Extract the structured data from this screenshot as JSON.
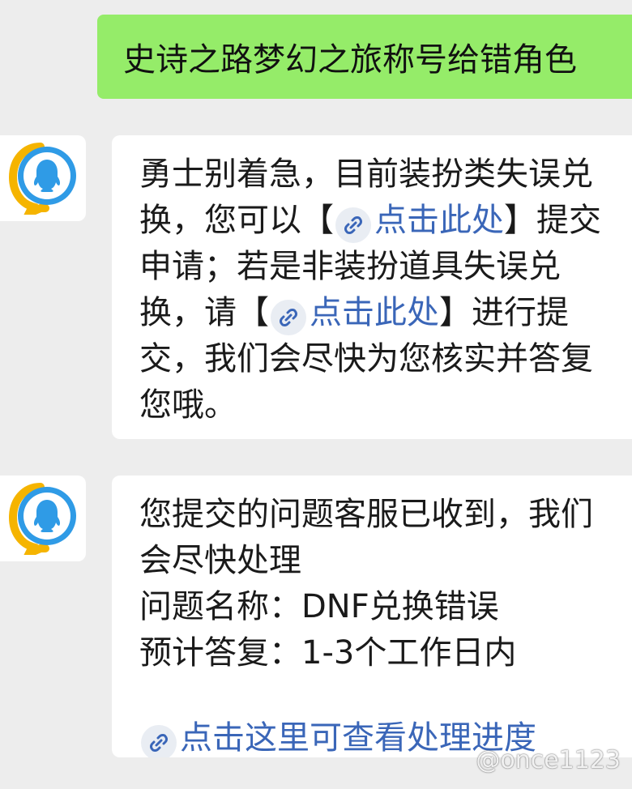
{
  "outgoing_message": {
    "text": "史诗之路梦幻之旅称号给错角色"
  },
  "reply_1": {
    "avatar_icon": "qq-service-bot-icon",
    "lines": {
      "l1": "勇士别着急，目前装扮类失误兑",
      "l2_pre": "换，您可以【",
      "l2_link": "点击此处",
      "l2_post": "】提交",
      "l3": "申请；若是非装扮道具失误兑",
      "l4_pre": "换，请【",
      "l4_link": "点击此处",
      "l4_post": "】进行提",
      "l5": "交，我们会尽快为您核实并答复",
      "l6": "您哦。"
    }
  },
  "reply_2": {
    "avatar_icon": "qq-service-bot-icon",
    "lines": {
      "l1": "您提交的问题客服已收到，我们",
      "l2": "会尽快处理",
      "l3": "问题名称：DNF兑换错误",
      "l4": "预计答复：1-3个工作日内"
    },
    "progress_link": "点击这里可查看处理进度"
  },
  "watermark": "@once1123",
  "colors": {
    "background": "#ededed",
    "outgoing_bubble": "#95ec69",
    "incoming_bubble": "#ffffff",
    "link": "#3a66b8"
  }
}
